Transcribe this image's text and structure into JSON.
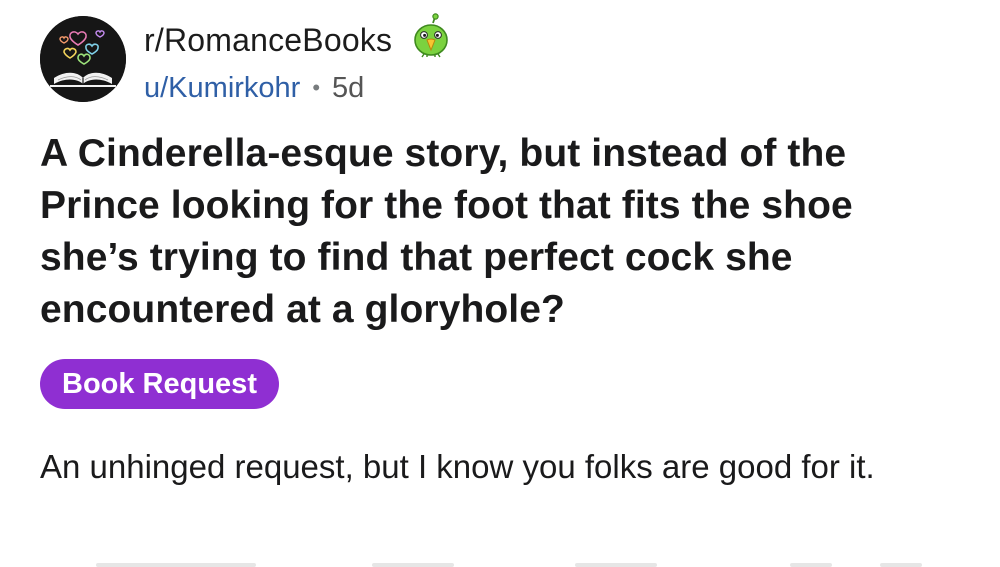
{
  "post": {
    "subreddit": "r/RomanceBooks",
    "author": "u/Kumirkohr",
    "separator": "•",
    "age": "5d",
    "title": "A Cinderella-esque story, but instead of the Prince looking for the foot that fits the shoe she’s trying to find that perfect cock she encountered at a gloryhole?",
    "flair": "Book Request",
    "body": "An unhinged request, but I know you folks are good for it."
  },
  "icons": {
    "subreddit_avatar": "book-hearts-icon",
    "user_avatar": "green-snoo-icon"
  },
  "colors": {
    "flair_background": "#8f2fd2",
    "username": "#2f5fa6",
    "avatar_background": "#161616",
    "snoo_green": "#7bd23f"
  }
}
